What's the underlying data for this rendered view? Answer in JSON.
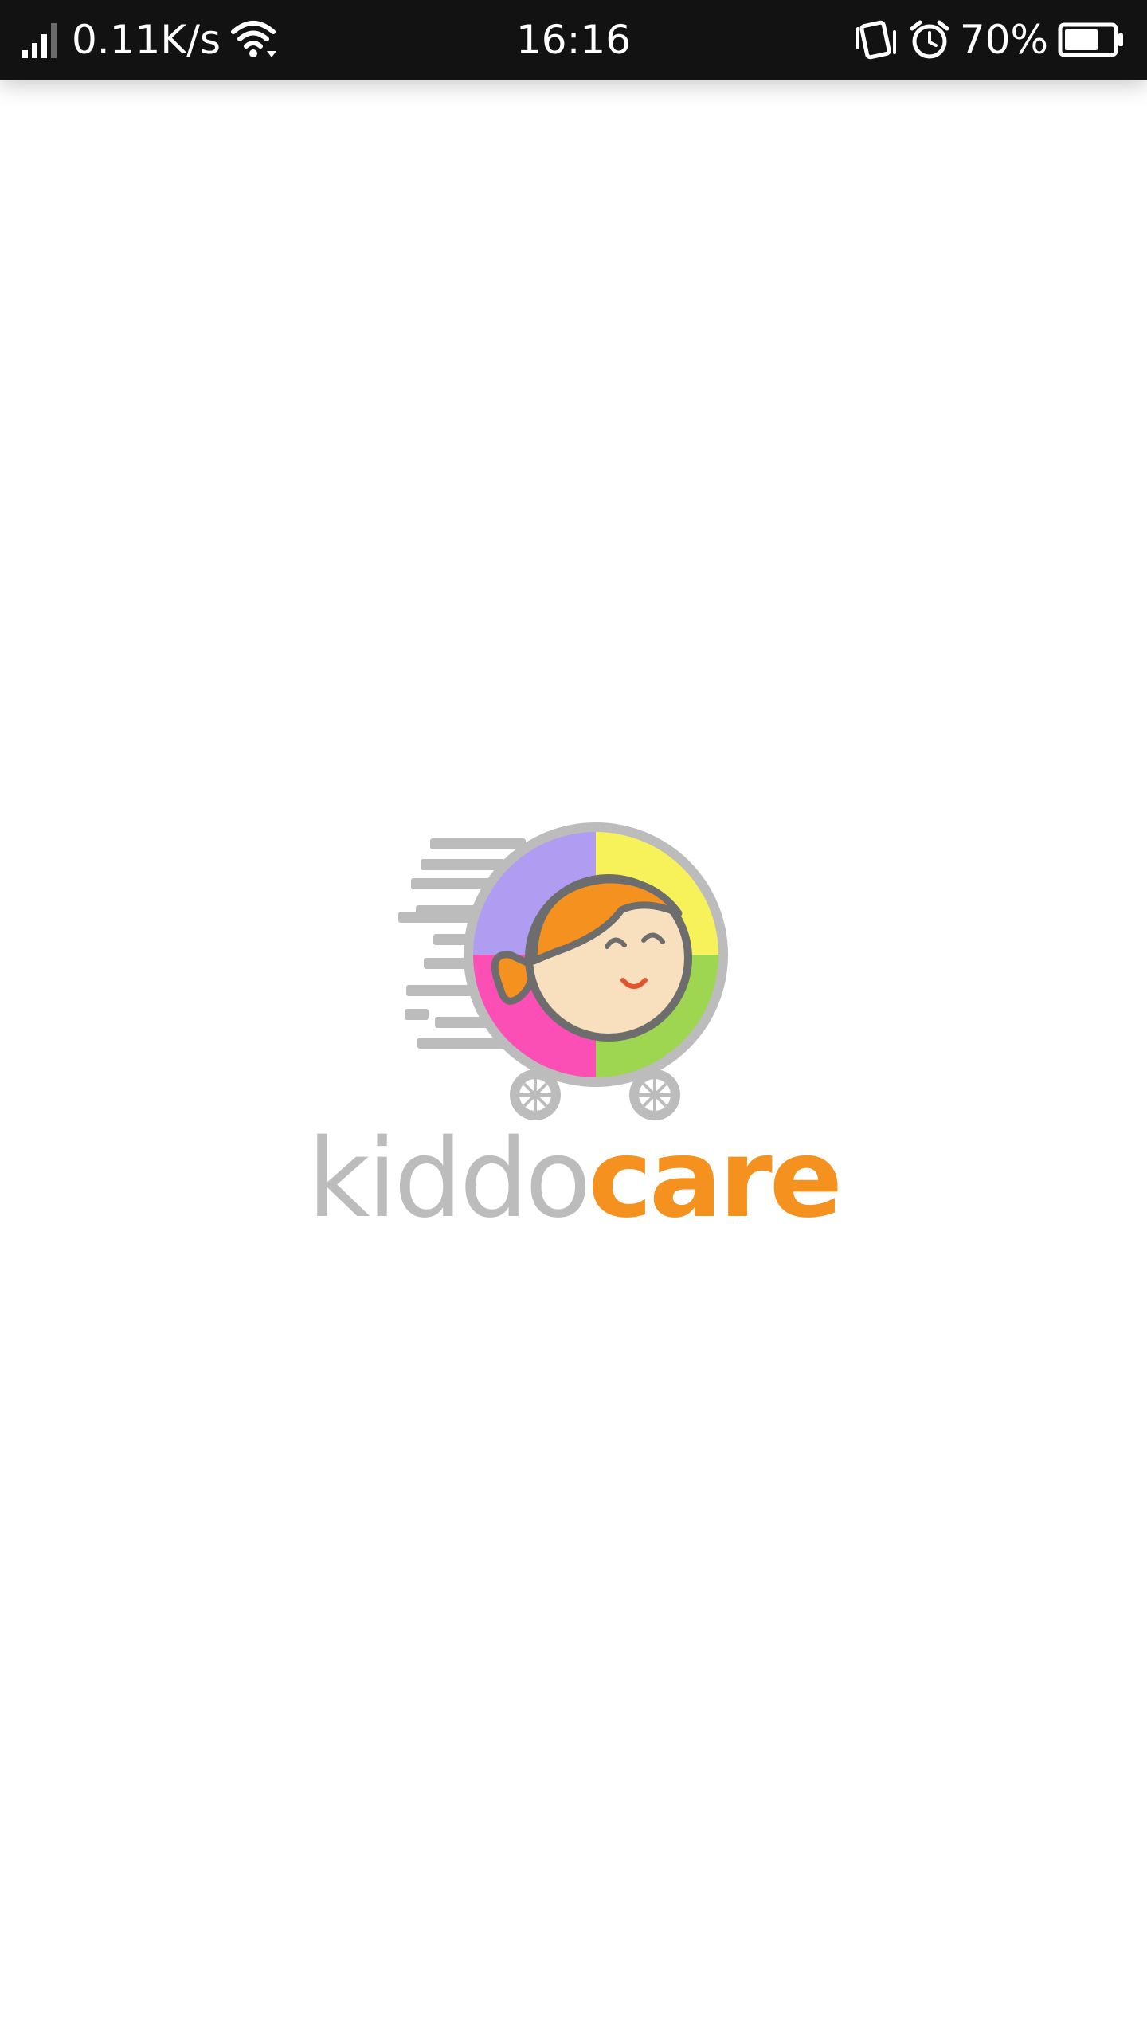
{
  "status_bar": {
    "network_speed": "0.11K/s",
    "time": "16:16",
    "battery_percent": "70%",
    "battery_level": 0.7,
    "icons": [
      "signal-icon",
      "wifi-icon",
      "vibrate-icon",
      "alarm-icon",
      "battery-icon"
    ]
  },
  "splash": {
    "brand_part_1": "kiddo",
    "brand_part_2": "care",
    "colors": {
      "grey": "#bcbcbc",
      "orange": "#f5911e",
      "purple": "#b09cf0",
      "yellow": "#f7f25a",
      "pink": "#fb4fb6",
      "green": "#9ed651",
      "skin": "#f8dfbd"
    }
  }
}
